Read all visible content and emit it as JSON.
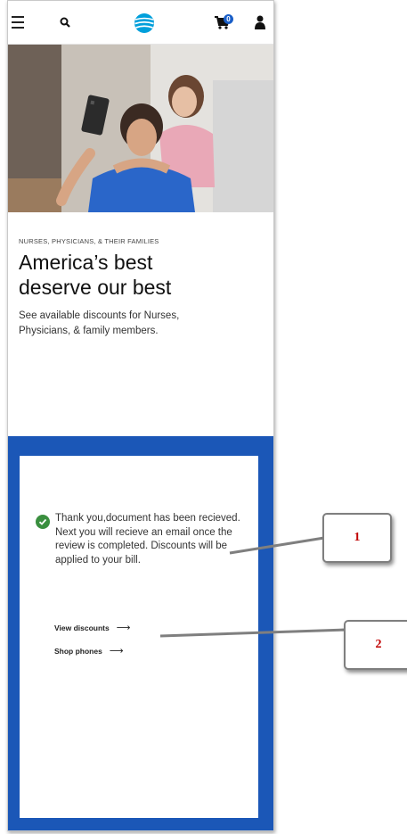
{
  "header": {
    "menu_icon": "hamburger-menu-icon",
    "search_icon": "search-icon",
    "logo_icon": "att-globe-logo-icon",
    "cart_icon": "cart-icon",
    "cart_count": "0",
    "account_icon": "user-account-icon"
  },
  "hero": {
    "image_subject": "photo",
    "colors": {
      "shirt": "#2a66c9",
      "background": "#e2dfda"
    }
  },
  "promo": {
    "eyebrow": "NURSES, PHYSICIANS, & THEIR FAMILIES",
    "headline_line1": "America’s best",
    "headline_line2": "deserve our best",
    "description": "See available discounts for Nurses, Physicians, & family members."
  },
  "confirmation": {
    "status_icon": "check-circle-icon",
    "message": "Thank you,document has been recieved. Next you will recieve an email once the review is completed. Discounts will be applied to your bill.",
    "links": [
      {
        "label": "View discounts",
        "arrow": "⟶"
      },
      {
        "label": "Shop phones",
        "arrow": "⟶"
      }
    ]
  },
  "annotations": {
    "callout_1": "1",
    "callout_2": "2"
  },
  "colors": {
    "panel_blue": "#1b57b7",
    "check_green": "#3a8f3f",
    "callout_text": "#c00000"
  }
}
